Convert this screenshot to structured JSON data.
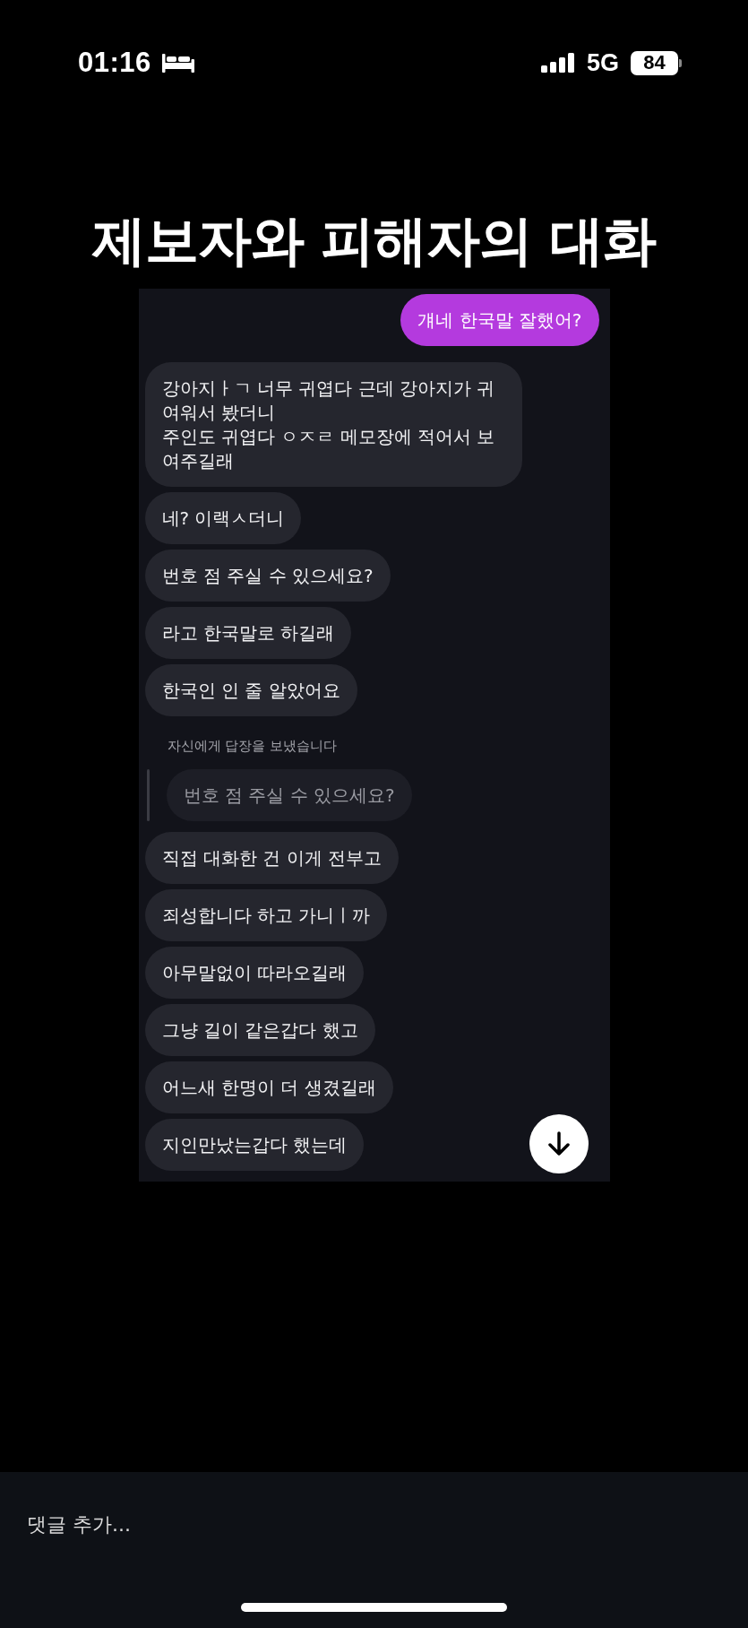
{
  "status_bar": {
    "time": "01:16",
    "network": "5G",
    "battery": "84"
  },
  "title": "제보자와 피해자의 대화",
  "chat": {
    "messages": [
      {
        "kind": "outgoing",
        "text": "걔네 한국말 잘했어?"
      },
      {
        "kind": "incoming",
        "text": "강아지ㅏㄱ 너무 귀엽다 근데 강아지가 귀여워서 봤더니\n주인도 귀엽다 ㅇㅈㄹ 메모장에 적어서 보여주길래"
      },
      {
        "kind": "incoming",
        "text": "네? 이랙ㅅ더니"
      },
      {
        "kind": "incoming",
        "text": "번호 점 주실 수 있으세요?"
      },
      {
        "kind": "incoming",
        "text": "라고 한국말로 하길래"
      },
      {
        "kind": "incoming",
        "text": "한국인 인 줄 알았어요"
      },
      {
        "kind": "notice",
        "text": "자신에게 답장을 보냈습니다"
      },
      {
        "kind": "quoted",
        "text": "번호 점 주실 수 있으세요?"
      },
      {
        "kind": "incoming",
        "text": "직접 대화한 건 이게 전부고"
      },
      {
        "kind": "incoming",
        "text": "죄성합니다 하고 가니ㅣ까"
      },
      {
        "kind": "incoming",
        "text": "아무말없이 따라오길래"
      },
      {
        "kind": "incoming",
        "text": "그냥 길이 같은갑다 했고"
      },
      {
        "kind": "incoming",
        "text": "어느새 한명이 더 생겼길래"
      },
      {
        "kind": "incoming",
        "text": "지인만났는갑다 했는데"
      }
    ]
  },
  "comment_bar": {
    "placeholder": "댓글 추가..."
  }
}
